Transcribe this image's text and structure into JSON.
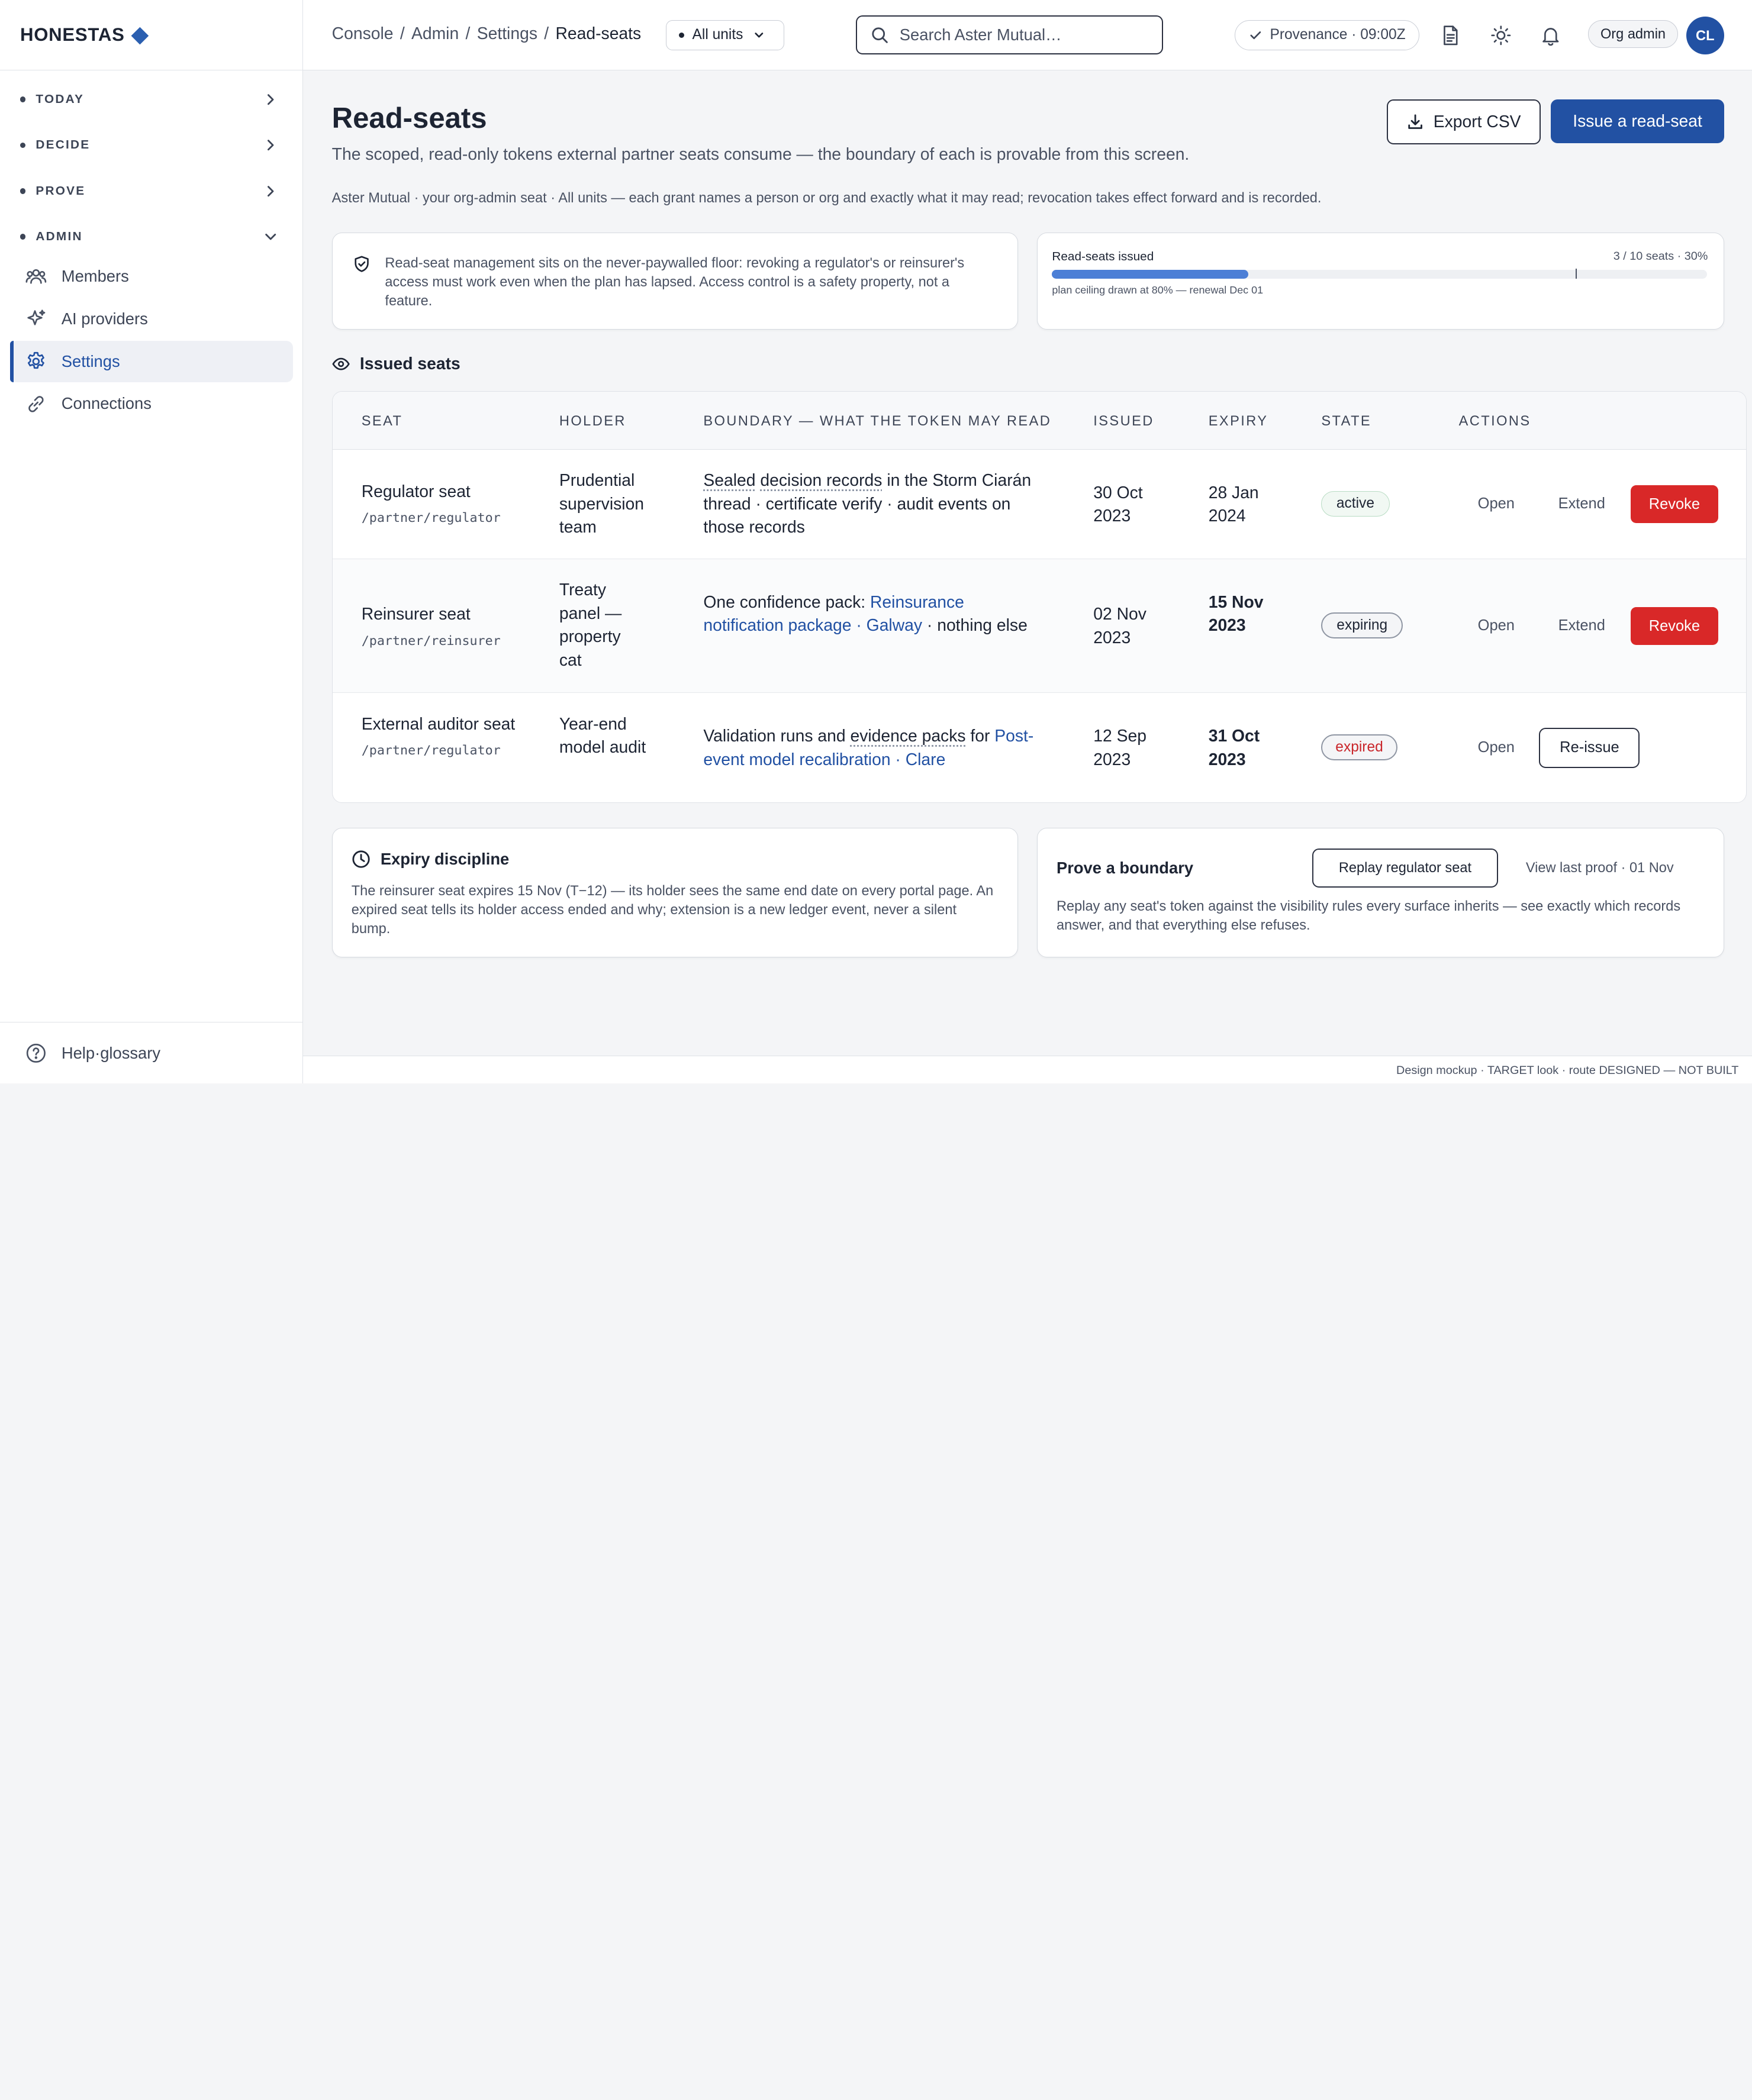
{
  "brand": {
    "name": "HONESTAS"
  },
  "sidebar": {
    "sections": [
      {
        "label": "TODAY",
        "expanded": false
      },
      {
        "label": "DECIDE",
        "expanded": false
      },
      {
        "label": "PROVE",
        "expanded": false
      },
      {
        "label": "ADMIN",
        "expanded": true
      }
    ],
    "items": [
      {
        "label": "Members",
        "icon": "users-icon"
      },
      {
        "label": "AI providers",
        "icon": "sparkle-icon"
      },
      {
        "label": "Settings",
        "icon": "gear-icon",
        "active": true
      },
      {
        "label": "Connections",
        "icon": "link-icon"
      }
    ],
    "help_label": "Help·glossary"
  },
  "topbar": {
    "breadcrumb": [
      "Console",
      "Admin",
      "Settings",
      "Read-seats"
    ],
    "unit_select": "All units",
    "search_placeholder": "Search Aster Mutual…",
    "provenance": "Provenance · 09:00Z",
    "org_role": "Org admin",
    "avatar_initials": "CL"
  },
  "page": {
    "title": "Read-seats",
    "subtitle": "The scoped, read-only tokens external partner seats consume — the boundary of each is provable from this screen.",
    "context": "Aster Mutual · your org-admin seat · All units — each grant names a person or org and exactly what it may read; revocation takes effect forward and is recorded.",
    "export_label": "Export CSV",
    "issue_label": "Issue a read-seat"
  },
  "floor_note": "Read-seat management sits on the never-paywalled floor: revoking a regulator's or reinsurer's access must work even when the plan has lapsed. Access control is a safety property, not a feature.",
  "quota": {
    "title": "Read-seats issued",
    "count": "3 / 10 seats · 30%",
    "fill_fraction": 0.3,
    "ceiling_fraction": 0.8,
    "note": "plan ceiling drawn at 80% — renewal Dec 01"
  },
  "issued": {
    "heading": "Issued seats",
    "columns": [
      "SEAT",
      "HOLDER",
      "BOUNDARY — WHAT THE TOKEN MAY READ",
      "ISSUED",
      "EXPIRY",
      "STATE",
      "ACTIONS"
    ],
    "rows": [
      {
        "seat": "Regulator seat",
        "path": "/partner/regulator",
        "holder": "Prudential supervision team",
        "b1": "Sealed",
        "b2": "decision records",
        "b3": "in the Storm Ciarán thread · certificate verify · audit events on those records",
        "issued": "30 Oct 2023",
        "expiry": "28 Jan 2024",
        "state": "active",
        "open": "Open",
        "extend": "Extend",
        "revoke": "Revoke"
      },
      {
        "seat": "Reinsurer seat",
        "path": "/partner/reinsurer",
        "holder": "Treaty panel — property cat",
        "b1": "One confidence pack:",
        "b2": "Reinsurance notification package · Galway",
        "b3": "· nothing else",
        "issued": "02 Nov 2023",
        "expiry": "15 Nov 2023",
        "state": "expiring",
        "open": "Open",
        "extend": "Extend",
        "revoke": "Revoke"
      },
      {
        "seat": "External auditor seat",
        "path": "/partner/regulator",
        "holder": "Year-end model audit",
        "b1": "Validation runs and",
        "b2": "evidence packs",
        "b3": "for",
        "b4": "Post-event model recalibration · Clare",
        "issued": "12 Sep 2023",
        "expiry": "31 Oct 2023",
        "state": "expired",
        "open": "Open",
        "reissue": "Re-issue"
      }
    ]
  },
  "expiry_card": {
    "title": "Expiry discipline",
    "body": "The reinsurer seat expires 15 Nov (T−12) — its holder sees the same end date on every portal page. An expired seat tells its holder access ended and why; extension is a new ledger event, never a silent bump."
  },
  "prove_card": {
    "title": "Prove a boundary",
    "replay_label": "Replay regulator seat",
    "last_proof": "View last proof · 01 Nov",
    "body": "Replay any seat's token against the visibility rules every surface inherits — see exactly which records answer, and that everything else refuses."
  },
  "footer": "Design mockup · TARGET look · route DESIGNED — NOT BUILT",
  "colors": {
    "accent": "#2251a3",
    "danger": "#d92828",
    "bar": "#4c7fd6"
  }
}
